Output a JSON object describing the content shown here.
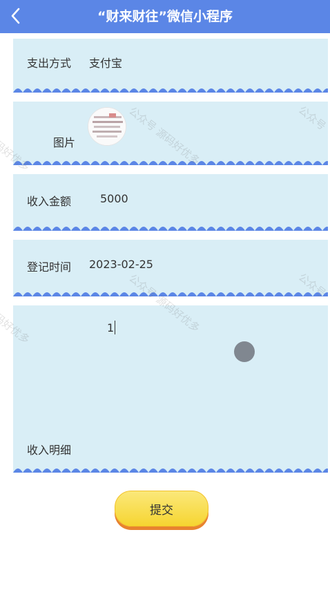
{
  "nav": {
    "title": "“财来财往”微信小程序"
  },
  "form": {
    "payment": {
      "label": "支出方式",
      "value": "支付宝"
    },
    "image": {
      "label": "图片"
    },
    "amount": {
      "label": "收入金额",
      "value": "5000"
    },
    "date": {
      "label": "登记时间",
      "value": "2023-02-25"
    },
    "detail": {
      "label": "收入明细",
      "value": "1"
    }
  },
  "submit_label": "提交",
  "watermark": [
    "公众号 源码好优多",
    "公众号",
    "源码好优多",
    "公众号 源码好优多",
    "公众号",
    "源码好优多"
  ]
}
